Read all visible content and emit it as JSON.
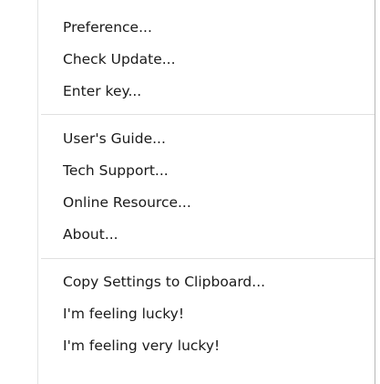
{
  "menu": {
    "groups": [
      {
        "items": [
          {
            "label": "Preference..."
          },
          {
            "label": "Check Update..."
          },
          {
            "label": "Enter key..."
          }
        ]
      },
      {
        "items": [
          {
            "label": "User's Guide..."
          },
          {
            "label": "Tech Support..."
          },
          {
            "label": "Online Resource..."
          },
          {
            "label": "About..."
          }
        ]
      },
      {
        "items": [
          {
            "label": "Copy Settings to Clipboard..."
          },
          {
            "label": "I'm feeling lucky!"
          },
          {
            "label": "I'm feeling very lucky!"
          }
        ]
      }
    ]
  }
}
